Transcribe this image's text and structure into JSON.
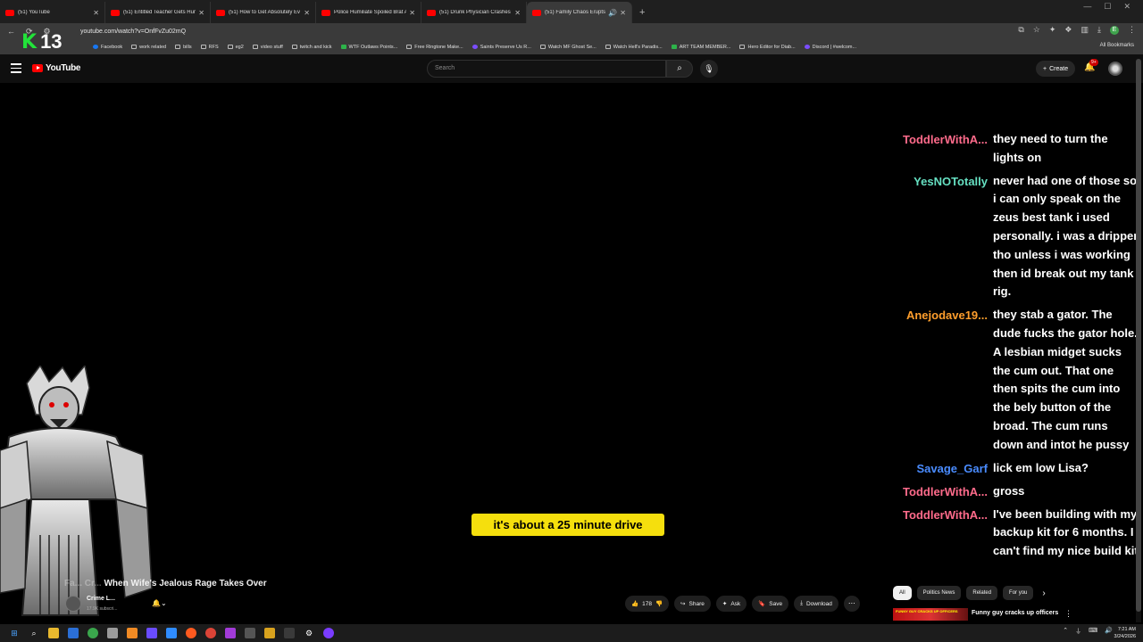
{
  "browser": {
    "tabs": [
      {
        "label": "(51) YouTube",
        "active": false
      },
      {
        "label": "(51) Entitled Teacher Gets Hum",
        "active": false
      },
      {
        "label": "(51) How to Get Absolutely Ev",
        "active": false
      },
      {
        "label": "Police Humiliate Spoiled Brat A",
        "active": false
      },
      {
        "label": "(51) Drunk Physician Crashes In",
        "active": false
      },
      {
        "label": "(51) Family Chaos Erupts W",
        "active": true
      }
    ],
    "url": "youtube.com/watch?v=OnfFvZu02mQ",
    "bookmarks": [
      {
        "label": "Facebook",
        "icon": "facebook-icon"
      },
      {
        "label": "work related",
        "icon": "folder-icon"
      },
      {
        "label": "bills",
        "icon": "folder-icon"
      },
      {
        "label": "RFS",
        "icon": "folder-icon"
      },
      {
        "label": "eg2",
        "icon": "folder-icon"
      },
      {
        "label": "video stuff",
        "icon": "folder-icon"
      },
      {
        "label": "twitch and kick",
        "icon": "folder-icon"
      },
      {
        "label": "WTF Outlaws Points...",
        "icon": "green-icon"
      },
      {
        "label": "Free Ringtone Make...",
        "icon": "site-icon"
      },
      {
        "label": "Saints Preserve Us R...",
        "icon": "purple-icon"
      },
      {
        "label": "Watch MF Ghost Se...",
        "icon": "site-icon"
      },
      {
        "label": "Watch Hell's Paradis...",
        "icon": "site-icon"
      },
      {
        "label": "ART TEAM MEMBER...",
        "icon": "green-icon"
      },
      {
        "label": "Hero Editor for Diab...",
        "icon": "site-icon"
      },
      {
        "label": "Discord | #welcom...",
        "icon": "purple-icon"
      }
    ],
    "all_bookmarks": "All Bookmarks"
  },
  "overlay": {
    "counter_letter": "K",
    "counter_value": "13"
  },
  "youtube": {
    "logo_text": "YouTube",
    "search_placeholder": "Search",
    "create_label": "Create",
    "notification_badge": "9+"
  },
  "chat": [
    {
      "user": "ToddlerWithA...",
      "color": "#ff6b8b",
      "text": "they need to turn the lights on"
    },
    {
      "user": "YesNOTotally",
      "color": "#66e0c2",
      "text": "never had one of those so i can only speak on the zeus best tank i used personally. i was a dripper tho unless i was working then id break out my tank rig."
    },
    {
      "user": "Anejodave19...",
      "color": "#ff9e2c",
      "text": "they stab a gator. The dude fucks the gator hole. A lesbian midget sucks the cum out. That one then spits the cum into the bely button of the broad. The cum runs down and intot he pussy"
    },
    {
      "user": "Savage_Garf",
      "color": "#4a8cff",
      "text": "lick em low Lisa?"
    },
    {
      "user": "ToddlerWithA...",
      "color": "#ff6b8b",
      "text": "gross"
    },
    {
      "user": "ToddlerWithA...",
      "color": "#ff6b8b",
      "text": "I've been building with my backup kit for 6 months. I can't find my nice build kit"
    }
  ],
  "caption": "it's about a 25 minute drive",
  "video": {
    "title_prefix": "Fa... Cr...",
    "title": "When Wife's Jealous Rage Takes Over",
    "channel_name": "Crime L...",
    "channel_subs": "17.9K subscri...",
    "likes": "178",
    "share_label": "Share",
    "ask_label": "Ask",
    "save_label": "Save",
    "download_label": "Download"
  },
  "sidebar_chips": [
    "All",
    "Politics News",
    "Related",
    "For you"
  ],
  "recommendation": {
    "thumb_text": "FUNNY GUY CRACKS UP OFFICERS",
    "title": "Funny guy cracks up officers"
  },
  "taskbar": {
    "time": "7:21 AM",
    "date": "3/24/2026"
  }
}
